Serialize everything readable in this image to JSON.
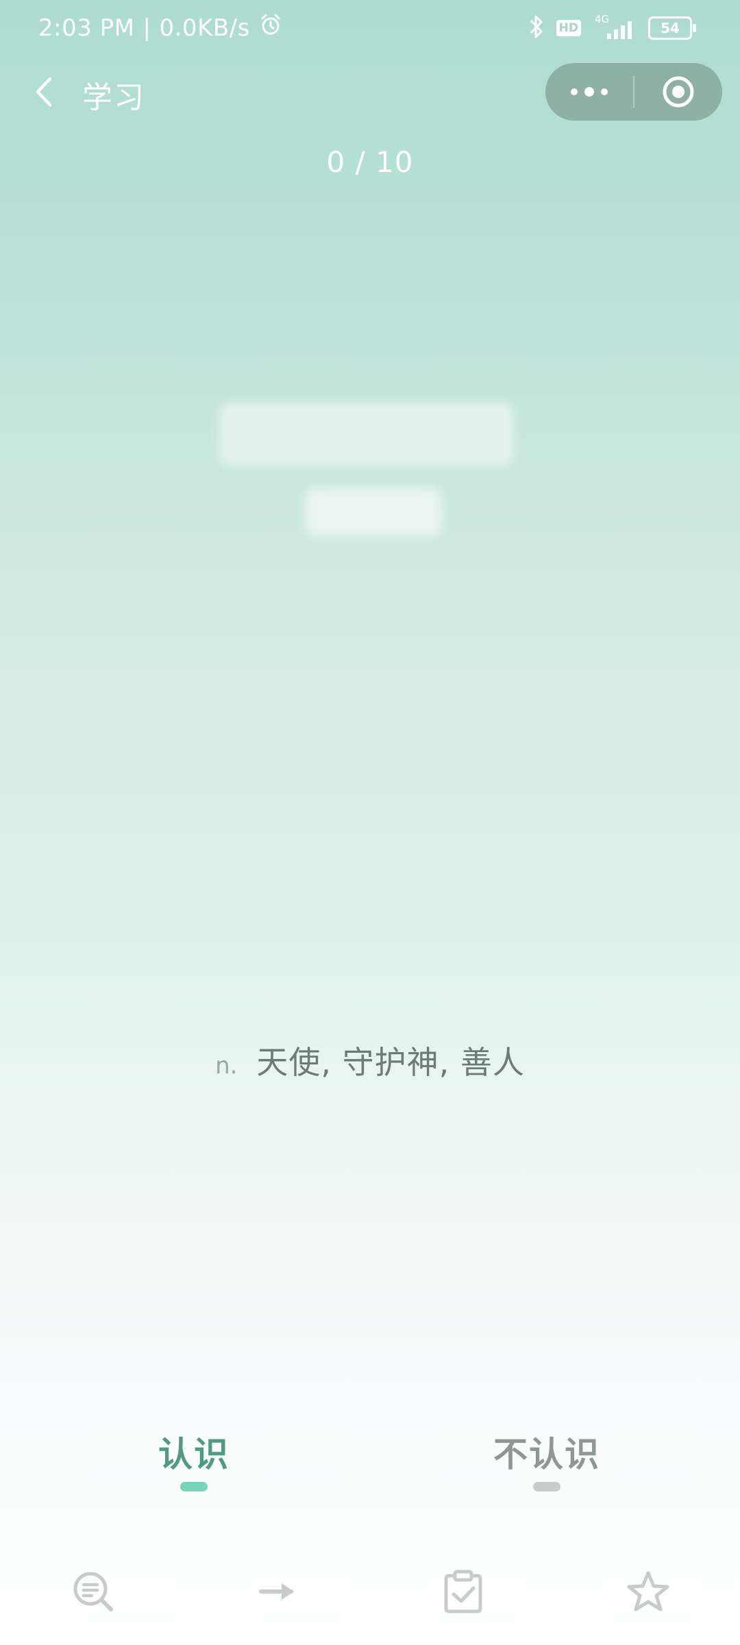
{
  "status_bar": {
    "time": "2:03 PM",
    "network_speed": "0.0KB/s",
    "icons": [
      "alarm-icon",
      "bluetooth-icon",
      "hd-icon",
      "signal-icon",
      "battery-icon"
    ],
    "hd_label": "HD",
    "network_type": "4G",
    "battery_level": "54"
  },
  "nav": {
    "title": "学习",
    "back_icon": "chevron-left-icon",
    "more_icon": "more-dots-icon",
    "close_icon": "target-circle-icon"
  },
  "progress": {
    "text": "0 / 10",
    "current": 0,
    "total": 10
  },
  "card": {
    "part_of_speech": "n.",
    "definition": "天使, 守护神, 善人"
  },
  "choices": {
    "know_label": "认识",
    "dont_know_label": "不认识"
  },
  "toolbar": {
    "icons": [
      "search-list-icon",
      "arrow-right-icon",
      "clipboard-check-icon",
      "star-icon"
    ]
  },
  "colors": {
    "know": "#4f9a80",
    "know_indicator": "#76d6b8",
    "dont_know": "#8f9796",
    "toolbar_icon": "#c7cccb"
  }
}
